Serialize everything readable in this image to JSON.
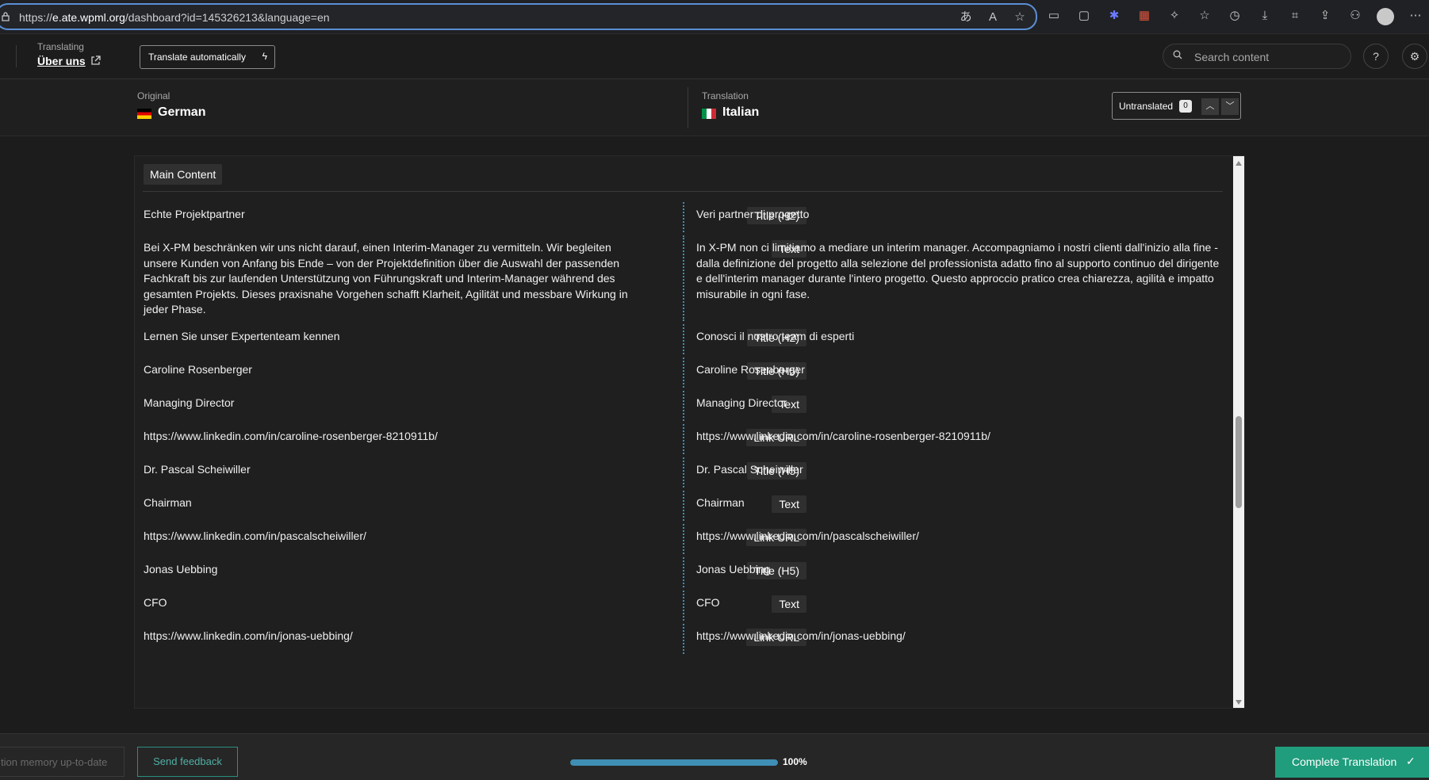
{
  "browser": {
    "url_prefix": "https://",
    "url_host": "e.ate.wpml.org",
    "url_path": "/dashboard?id=145326213&language=en"
  },
  "header": {
    "translating_label": "Translating",
    "page_title": "Über uns",
    "translate_auto_label": "Translate automatically",
    "search_placeholder": "Search content"
  },
  "languages": {
    "original_caption": "Original",
    "original_name": "German",
    "translation_caption": "Translation",
    "translation_name": "Italian",
    "filter_label": "Untranslated",
    "filter_count": "0"
  },
  "section": {
    "label": "Main Content"
  },
  "rows": [
    {
      "source": "Echte Projektpartner",
      "tag": "Title (H2)",
      "target": "Veri partner di progetto"
    },
    {
      "source": "Bei X-PM beschränken wir uns nicht darauf, einen Interim-Manager zu vermitteln. Wir begleiten unsere Kunden von Anfang bis Ende – von der Projektdefinition über die Auswahl der passenden Fachkraft bis zur laufenden Unterstützung von Führungskraft und Interim-Manager während des gesamten Projekts. Dieses praxisnahe Vorgehen schafft Klarheit, Agilität und messbare Wirkung in jeder Phase.",
      "tag": "Text",
      "target": "In X-PM non ci limitiamo a mediare un interim manager. Accompagniamo i nostri clienti dall'inizio alla fine - dalla definizione del progetto alla selezione del professionista adatto fino al supporto continuo del dirigente e dell'interim manager durante l'intero progetto. Questo approccio pratico crea chiarezza, agilità e impatto misurabile in ogni fase."
    },
    {
      "source": "Lernen Sie unser Expertenteam kennen",
      "tag": "Title (H2)",
      "target": "Conosci il nostro team di esperti"
    },
    {
      "source": "Caroline Rosenberger",
      "tag": "Title (H5)",
      "target": "Caroline Rosenberger"
    },
    {
      "source": "Managing Director",
      "tag": "Text",
      "target": "Managing Director"
    },
    {
      "source": "https://www.linkedin.com/in/caroline-rosenberger-8210911b/",
      "tag": "Link URL",
      "target": "https://www.linkedin.com/in/caroline-rosenberger-8210911b/"
    },
    {
      "source": "Dr. Pascal Scheiwiller",
      "tag": "Title (H5)",
      "target": "Dr. Pascal Scheiwiller"
    },
    {
      "source": "Chairman",
      "tag": "Text",
      "target": "Chairman"
    },
    {
      "source": "https://www.linkedin.com/in/pascalscheiwiller/",
      "tag": "Link URL",
      "target": "https://www.linkedin.com/in/pascalscheiwiller/"
    },
    {
      "source": "Jonas Uebbing",
      "tag": "Title (H5)",
      "target": "Jonas Uebbing"
    },
    {
      "source": "CFO",
      "tag": "Text",
      "target": "CFO"
    },
    {
      "source": "https://www.linkedin.com/in/jonas-uebbing/",
      "tag": "Link URL",
      "target": "https://www.linkedin.com/in/jonas-uebbing/"
    }
  ],
  "footer": {
    "tm_label": "tion memory up-to-date",
    "feedback_label": "Send feedback",
    "progress_value": 1.0,
    "progress_label": "100%",
    "complete_label": "Complete Translation"
  },
  "colors": {
    "accent": "#3f8fb5",
    "complete": "#1f9d7c",
    "background": "#1c1c1c"
  }
}
